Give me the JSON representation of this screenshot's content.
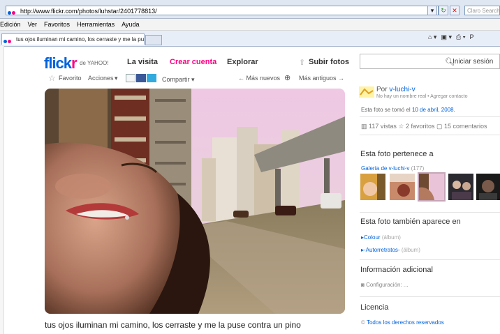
{
  "browser": {
    "url": "http://www.flickr.com/photos/luhstar/2401778813/",
    "search_placeholder": "Claro Search",
    "menu": [
      "Edición",
      "Ver",
      "Favoritos",
      "Herramientas",
      "Ayuda"
    ],
    "tab_title": "tus ojos iluminan mi camino, los cerraste y me la puse ...",
    "command_suffix": "P"
  },
  "flickr": {
    "logo_main": "flick",
    "logo_r": "r",
    "logo_sub": "de YAHOO!",
    "nav": {
      "tour": "La visita",
      "signup": "Crear cuenta",
      "explore": "Explorar",
      "upload": "Subir fotos"
    },
    "search_button": "Iniciar sesión"
  },
  "photo_toolbar": {
    "favorite": "Favorito",
    "actions": "Acciones",
    "share": "Compartir",
    "newer": "← Más nuevos",
    "older": "Más antiguos →"
  },
  "photo": {
    "title": "tus ojos iluminan mi camino, los cerraste y me la puse contra un pino"
  },
  "sidebar": {
    "by_prefix": "Por",
    "owner": "v-luchi-v",
    "owner_sub": "No hay un nombre real  • Agregar contacto",
    "taken_prefix": "Esta foto se tomó el",
    "taken_date": "10 de abril, 2008",
    "taken_suffix": ".",
    "stats": "117 vistas   ☆ 2 favoritos   ▢ 15 comentarios",
    "belongs_heading": "Esta foto pertenece a",
    "gallery_link": "Galería de v-luchi-v",
    "gallery_count": "(177)",
    "also_heading": "Esta foto también aparece en",
    "sets": [
      {
        "name": "Colour",
        "tag": "(álbum)"
      },
      {
        "name": "-Autorretratos-",
        "tag": "(álbum)"
      }
    ],
    "info_heading": "Información adicional",
    "config": "Configuración: ...",
    "license_heading": "Licencia",
    "license": "Todos los derechos reservados"
  },
  "colors": {
    "flickr_blue": "#0063dc",
    "flickr_pink": "#ff0084"
  }
}
